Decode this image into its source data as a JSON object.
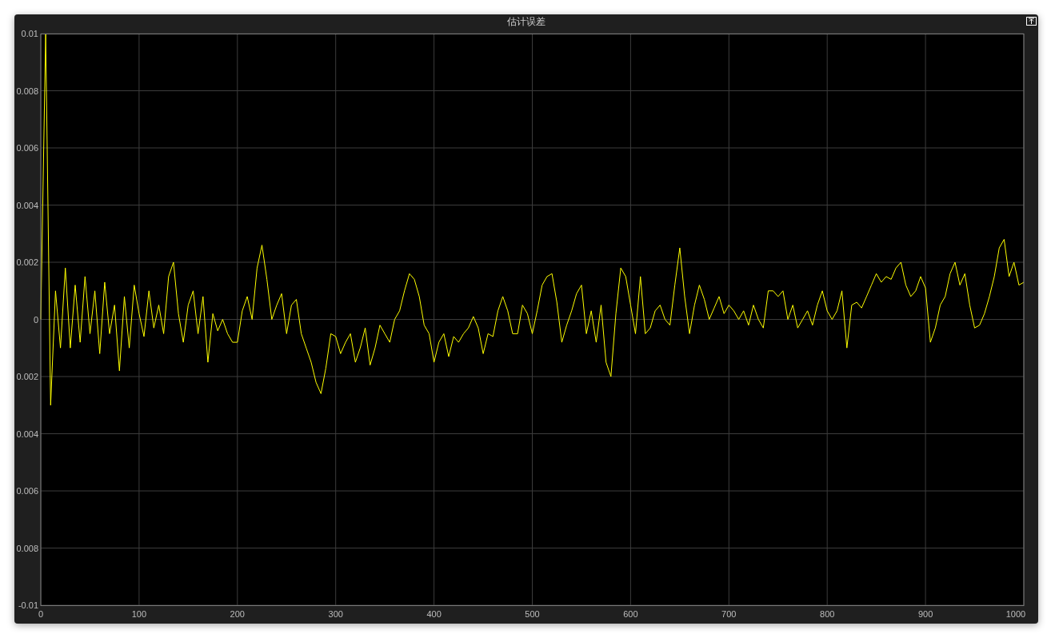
{
  "window": {
    "title": "估计误差"
  },
  "plot": {
    "chart_data": {
      "type": "line",
      "grid": true,
      "xlim": [
        0,
        1000
      ],
      "ylim": [
        -0.01,
        0.01
      ],
      "xticks": [
        0,
        100,
        200,
        300,
        400,
        500,
        600,
        700,
        800,
        900,
        1000
      ],
      "yticks": [
        0.01,
        0.008,
        0.006,
        0.004,
        0.002,
        0,
        {
          "value": -0.002,
          "label": "0.002"
        },
        {
          "value": -0.004,
          "label": "0.004"
        },
        {
          "value": -0.006,
          "label": "0.006"
        },
        {
          "value": -0.008,
          "label": "0.008"
        },
        {
          "value": -0.01,
          "label": "-0.01"
        }
      ],
      "x": [
        0,
        5,
        10,
        15,
        20,
        25,
        30,
        35,
        40,
        45,
        50,
        55,
        60,
        65,
        70,
        75,
        80,
        85,
        90,
        95,
        100,
        105,
        110,
        115,
        120,
        125,
        130,
        135,
        140,
        145,
        150,
        155,
        160,
        165,
        170,
        175,
        180,
        185,
        190,
        195,
        200,
        205,
        210,
        215,
        220,
        225,
        230,
        235,
        240,
        245,
        250,
        255,
        260,
        265,
        270,
        275,
        280,
        285,
        290,
        295,
        300,
        305,
        310,
        315,
        320,
        325,
        330,
        335,
        340,
        345,
        350,
        355,
        360,
        365,
        370,
        375,
        380,
        385,
        390,
        395,
        400,
        405,
        410,
        415,
        420,
        425,
        430,
        435,
        440,
        445,
        450,
        455,
        460,
        465,
        470,
        475,
        480,
        485,
        490,
        495,
        500,
        505,
        510,
        515,
        520,
        525,
        530,
        535,
        540,
        545,
        550,
        555,
        560,
        565,
        570,
        575,
        580,
        585,
        590,
        595,
        600,
        605,
        610,
        615,
        620,
        625,
        630,
        635,
        640,
        645,
        650,
        655,
        660,
        665,
        670,
        675,
        680,
        685,
        690,
        695,
        700,
        705,
        710,
        715,
        720,
        725,
        730,
        735,
        740,
        745,
        750,
        755,
        760,
        765,
        770,
        775,
        780,
        785,
        790,
        795,
        800,
        805,
        810,
        815,
        820,
        825,
        830,
        835,
        840,
        845,
        850,
        855,
        860,
        865,
        870,
        875,
        880,
        885,
        890,
        895,
        900,
        905,
        910,
        915,
        920,
        925,
        930,
        935,
        940,
        945,
        950,
        955,
        960,
        965,
        970,
        975,
        980,
        985,
        990,
        995,
        1000
      ],
      "series": [
        {
          "color": "#ffff00",
          "values": [
            0,
            0.01,
            -0.003,
            0.001,
            -0.001,
            0.0018,
            -0.001,
            0.0012,
            -0.0008,
            0.0015,
            -0.0005,
            0.001,
            -0.0012,
            0.0013,
            -0.0005,
            0.0005,
            -0.0018,
            0.0008,
            -0.001,
            0.0012,
            0.0002,
            -0.0006,
            0.001,
            -0.0003,
            0.0005,
            -0.0005,
            0.0015,
            0.002,
            0.0002,
            -0.0008,
            0.0005,
            0.001,
            -0.0005,
            0.0008,
            -0.0015,
            0.0002,
            -0.0004,
            0,
            -0.0005,
            -0.0008,
            -0.0008,
            0.0003,
            0.0008,
            0,
            0.0018,
            0.0026,
            0.0014,
            0,
            0.0005,
            0.0009,
            -0.0005,
            0.0005,
            0.0007,
            -0.0005,
            -0.001,
            -0.0015,
            -0.0022,
            -0.0026,
            -0.0017,
            -0.0005,
            -0.0006,
            -0.0012,
            -0.0008,
            -0.0005,
            -0.0015,
            -0.001,
            -0.0003,
            -0.0016,
            -0.001,
            -0.0002,
            -0.0005,
            -0.0008,
            0,
            0.0003,
            0.001,
            0.0016,
            0.0014,
            0.0008,
            -0.0002,
            -0.0005,
            -0.0015,
            -0.0008,
            -0.0005,
            -0.0013,
            -0.0006,
            -0.0008,
            -0.0005,
            -0.0003,
            0.0001,
            -0.0003,
            -0.0012,
            -0.0005,
            -0.0006,
            0.0003,
            0.0008,
            0.0003,
            -0.0005,
            -0.0005,
            0.0005,
            0.0002,
            -0.0005,
            0.0003,
            0.0012,
            0.0015,
            0.0016,
            0.0006,
            -0.0008,
            -0.0002,
            0.0003,
            0.0009,
            0.0012,
            -0.0005,
            0.0003,
            -0.0008,
            0.0005,
            -0.0015,
            -0.002,
            0.0002,
            0.0018,
            0.0015,
            0.0005,
            -0.0005,
            0.0015,
            -0.0005,
            -0.0003,
            0.0003,
            0.0005,
            0,
            -0.0002,
            0.0012,
            0.0025,
            0.0008,
            -0.0005,
            0.0005,
            0.0012,
            0.0007,
            0,
            0.0004,
            0.0008,
            0.0002,
            0.0005,
            0.0003,
            0,
            0.0003,
            -0.0002,
            0.0005,
            0,
            -0.0003,
            0.001,
            0.001,
            0.0008,
            0.001,
            0,
            0.0005,
            -0.0003,
            0,
            0.0003,
            -0.0002,
            0.0005,
            0.001,
            0.0003,
            0,
            0.0003,
            0.001,
            -0.001,
            0.0005,
            0.0006,
            0.0004,
            0.0008,
            0.0012,
            0.0016,
            0.0013,
            0.0015,
            0.0014,
            0.0018,
            0.002,
            0.0012,
            0.0008,
            0.001,
            0.0015,
            0.0011,
            -0.0008,
            -0.0003,
            0.0005,
            0.0008,
            0.0016,
            0.002,
            0.0012,
            0.0016,
            0.0005,
            -0.0003,
            -0.0002,
            0.0002,
            0.0008,
            0.0015,
            0.0025,
            0.0028,
            0.0015,
            0.002,
            0.0012,
            0.0013
          ]
        }
      ]
    }
  }
}
